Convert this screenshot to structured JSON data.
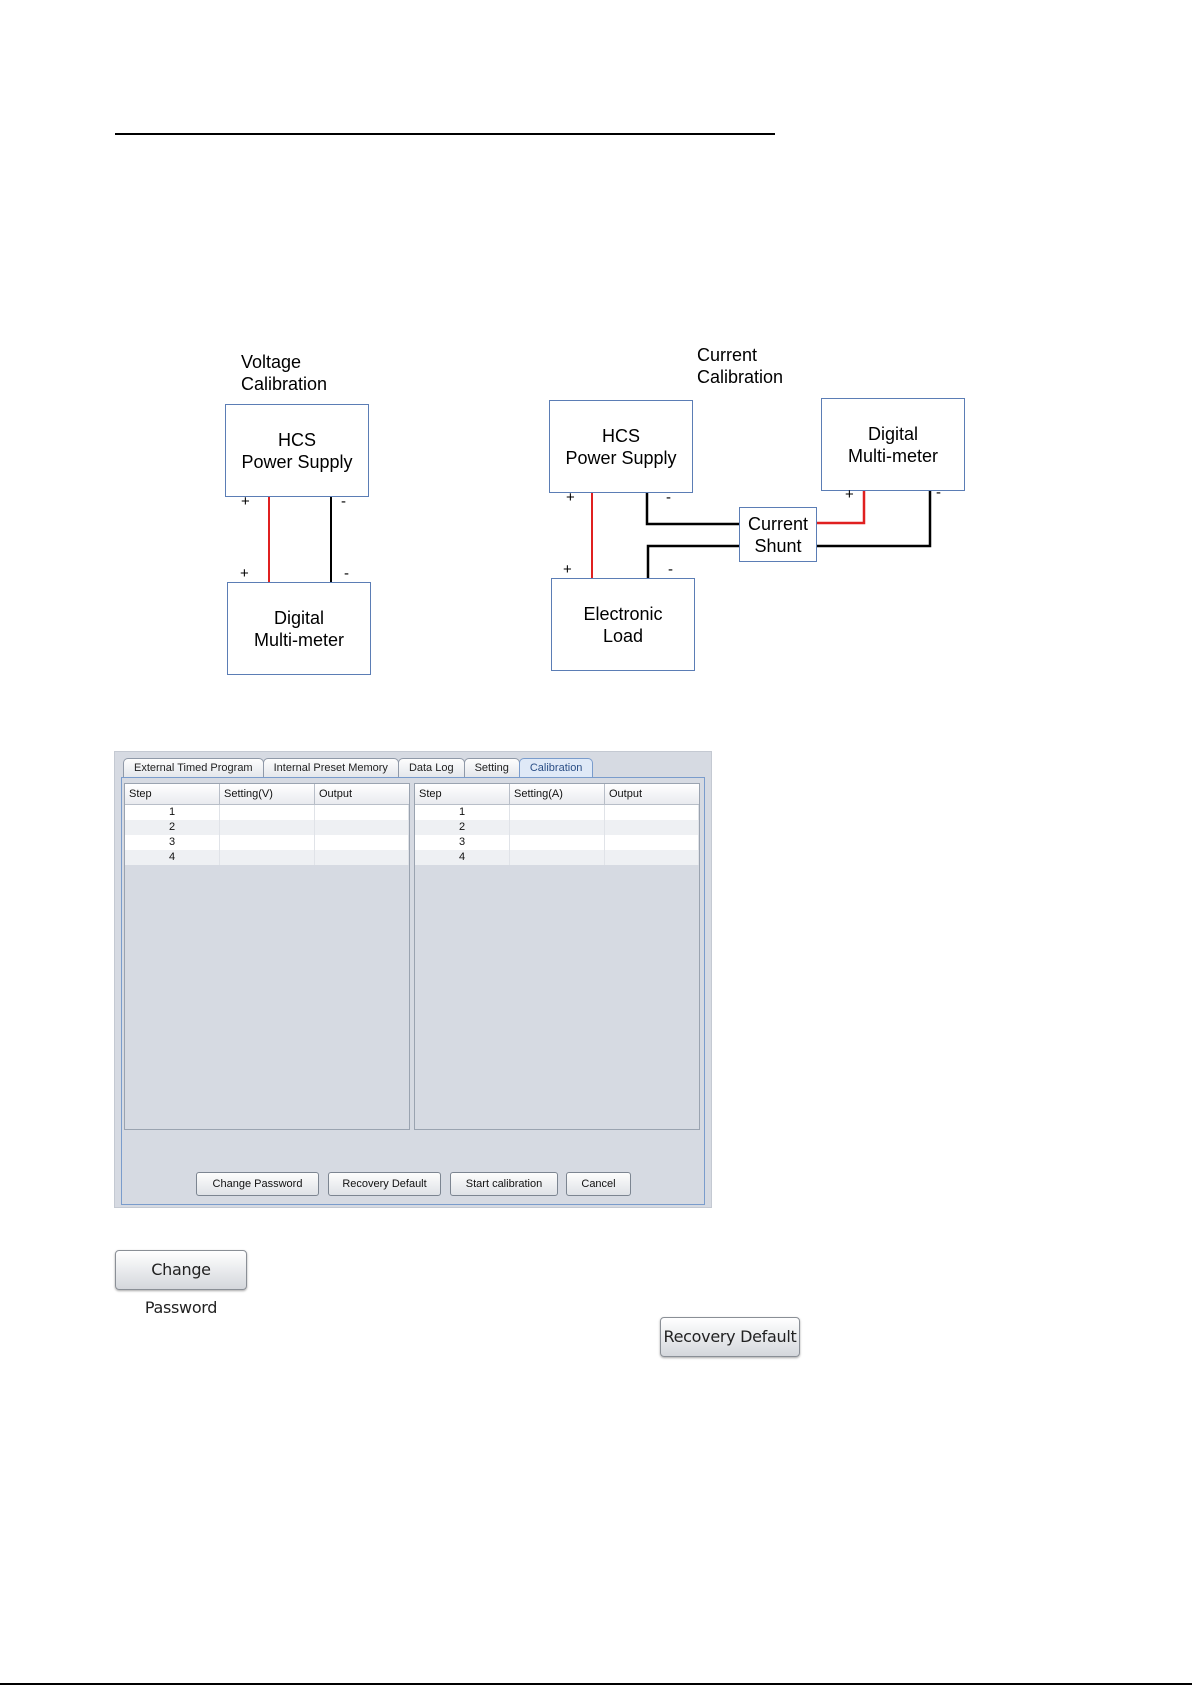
{
  "diagrams": {
    "voltage": {
      "title_line1": "Voltage",
      "title_line2": "Calibration",
      "supply_line1": "HCS",
      "supply_line2": "Power Supply",
      "meter_line1": "Digital",
      "meter_line2": "Multi-meter",
      "pin_plus": "+",
      "pin_minus": "-"
    },
    "current": {
      "title_line1": "Current",
      "title_line2": "Calibration",
      "supply_line1": "HCS",
      "supply_line2": "Power Supply",
      "meter_line1": "Digital",
      "meter_line2": "Multi-meter",
      "shunt_line1": "Current",
      "shunt_line2": "Shunt",
      "load_line1": "Electronic",
      "load_line2": "Load",
      "pin_plus": "+",
      "pin_minus": "-"
    },
    "colors": {
      "box_border": "#5b7db5",
      "wire_positive": "#e02020",
      "wire_negative": "#000000"
    }
  },
  "app": {
    "tabs": [
      {
        "label": "External Timed Program",
        "active": false
      },
      {
        "label": "Internal Preset Memory",
        "active": false
      },
      {
        "label": "Data Log",
        "active": false
      },
      {
        "label": "Setting",
        "active": false
      },
      {
        "label": "Calibration",
        "active": true
      }
    ],
    "voltage_table": {
      "headers": [
        "Step",
        "Setting(V)",
        "Output"
      ],
      "rows": [
        {
          "step": "1",
          "setting": "",
          "output": ""
        },
        {
          "step": "2",
          "setting": "",
          "output": ""
        },
        {
          "step": "3",
          "setting": "",
          "output": ""
        },
        {
          "step": "4",
          "setting": "",
          "output": ""
        }
      ]
    },
    "current_table": {
      "headers": [
        "Step",
        "Setting(A)",
        "Output"
      ],
      "rows": [
        {
          "step": "1",
          "setting": "",
          "output": ""
        },
        {
          "step": "2",
          "setting": "",
          "output": ""
        },
        {
          "step": "3",
          "setting": "",
          "output": ""
        },
        {
          "step": "4",
          "setting": "",
          "output": ""
        }
      ]
    },
    "buttons": {
      "change_password": "Change Password",
      "recovery_default": "Recovery Default",
      "start_calibration": "Start calibration",
      "cancel": "Cancel"
    }
  },
  "zoomed_buttons": {
    "change_password": "Change Password",
    "recovery_default": "Recovery Default"
  }
}
